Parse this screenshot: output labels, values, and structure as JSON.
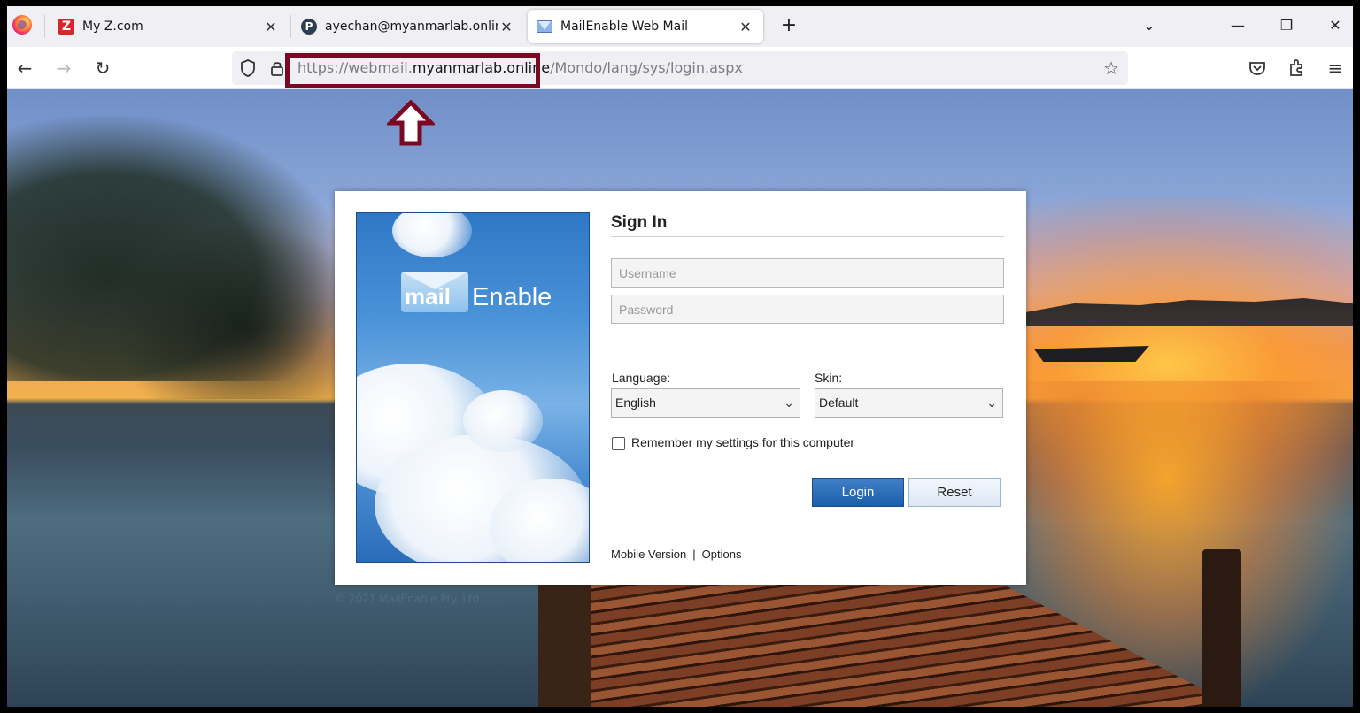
{
  "browser": {
    "tabs": [
      {
        "label": "My Z.com",
        "icon": "zcom-favicon",
        "active": false
      },
      {
        "label": "ayechan@myanmarlab.online -",
        "icon": "profile-p-favicon",
        "active": false
      },
      {
        "label": "MailEnable Web Mail",
        "icon": "mail-envelope-favicon",
        "active": true
      }
    ],
    "new_tab_symbol": "+",
    "url": {
      "prefix": "https://webmail.",
      "host": "myanmarlab.online",
      "path": "/Mondo/lang/sys/login.aspx"
    },
    "icons": [
      "firefox-icon",
      "back-icon",
      "forward-icon",
      "reload-icon",
      "shield-icon",
      "lock-icon",
      "bookmark-star-icon",
      "pocket-icon",
      "extensions-icon",
      "menu-icon",
      "list-tabs-icon",
      "minimize-icon",
      "restore-icon",
      "close-icon"
    ]
  },
  "annotation": {
    "highlight_color": "#7a0a24"
  },
  "login": {
    "title": "Sign In",
    "username_placeholder": "Username",
    "password_placeholder": "Password",
    "language_label": "Language:",
    "language_value": "English",
    "skin_label": "Skin:",
    "skin_value": "Default",
    "remember_label": "Remember my settings for this computer",
    "login_button": "Login",
    "reset_button": "Reset",
    "mobile_link": "Mobile Version",
    "link_separator": "|",
    "options_link": "Options",
    "brand_mail": "mail",
    "brand_enable": "Enable",
    "accent_color": "#1c5ea8"
  },
  "page": {
    "copyright": "© 2021 MailEnable Pty. Ltd."
  }
}
